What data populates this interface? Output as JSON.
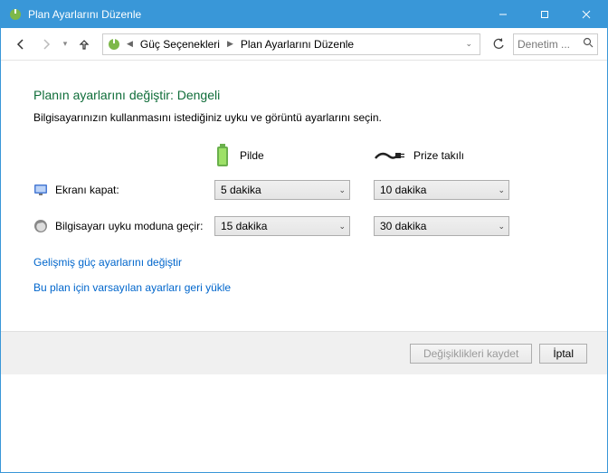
{
  "window": {
    "title": "Plan Ayarlarını Düzenle"
  },
  "breadcrumbs": {
    "level1": "Güç Seçenekleri",
    "level2": "Plan Ayarlarını Düzenle"
  },
  "search": {
    "placeholder": "Denetim ..."
  },
  "page": {
    "heading": "Planın ayarlarını değiştir: Dengeli",
    "subhead": "Bilgisayarınızın kullanmasını istediğiniz uyku ve görüntü ayarlarını seçin."
  },
  "columns": {
    "battery": "Pilde",
    "plugged": "Prize takılı"
  },
  "rows": {
    "display_off": {
      "label": "Ekranı kapat:",
      "battery": "5 dakika",
      "plugged": "10 dakika"
    },
    "sleep": {
      "label": "Bilgisayarı uyku moduna geçir:",
      "battery": "15 dakika",
      "plugged": "30 dakika"
    }
  },
  "links": {
    "advanced": "Gelişmiş güç ayarlarını değiştir",
    "restore": "Bu plan için varsayılan ayarları geri yükle"
  },
  "buttons": {
    "save": "Değişiklikleri kaydet",
    "cancel": "İptal"
  }
}
